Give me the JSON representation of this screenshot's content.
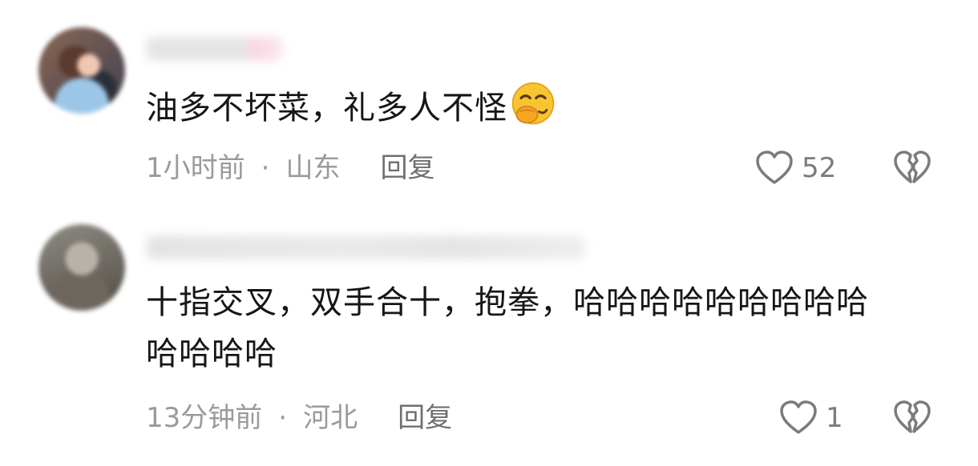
{
  "comments": [
    {
      "text": "油多不坏菜，礼多人不怪",
      "emoji_icon": "face-with-hand-over-mouth-emoji",
      "time": "1小时前",
      "separator": "·",
      "location": "山东",
      "reply_label": "回复",
      "like_count": "52"
    },
    {
      "text": "十指交叉，双手合十，抱拳，哈哈哈哈哈哈哈哈哈\n哈哈哈哈",
      "time": "13分钟前",
      "separator": "·",
      "location": "河北",
      "reply_label": "回复",
      "like_count": "1"
    }
  ],
  "icons": {
    "like": "heart-outline-icon",
    "dislike": "broken-heart-icon"
  },
  "colors": {
    "text": "#161616",
    "meta": "#9a9a9a",
    "reply": "#6f6f6f",
    "icon": "#7b7b7b",
    "emoji": "#f7b731"
  }
}
